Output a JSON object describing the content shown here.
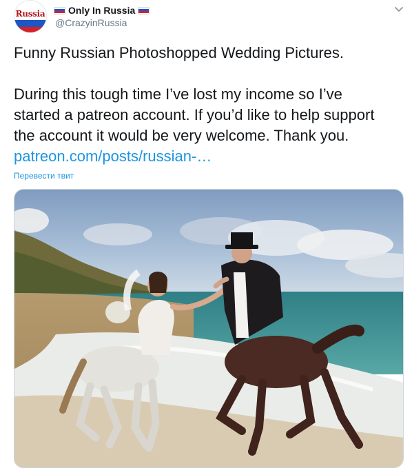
{
  "account": {
    "display_name": "Only In Russia",
    "handle": "@CrazyinRussia",
    "avatar_text": "Russia"
  },
  "tweet": {
    "line1": "Funny Russian Photoshopped Wedding Pictures.",
    "line2": "During this tough time I’ve lost my income so I’ve",
    "line3": "started a patreon account. If you’d like to help support",
    "line4": "the account it would be very welcome. Thank you.",
    "link": "patreon.com/posts/russian-…",
    "translate_label": "Перевести твит"
  },
  "icons": {
    "menu": "chevron-down-icon",
    "flag": "russian-flag-icon"
  },
  "colors": {
    "link": "#1b95e0",
    "secondary_text": "#657786",
    "primary_text": "#14171a"
  }
}
